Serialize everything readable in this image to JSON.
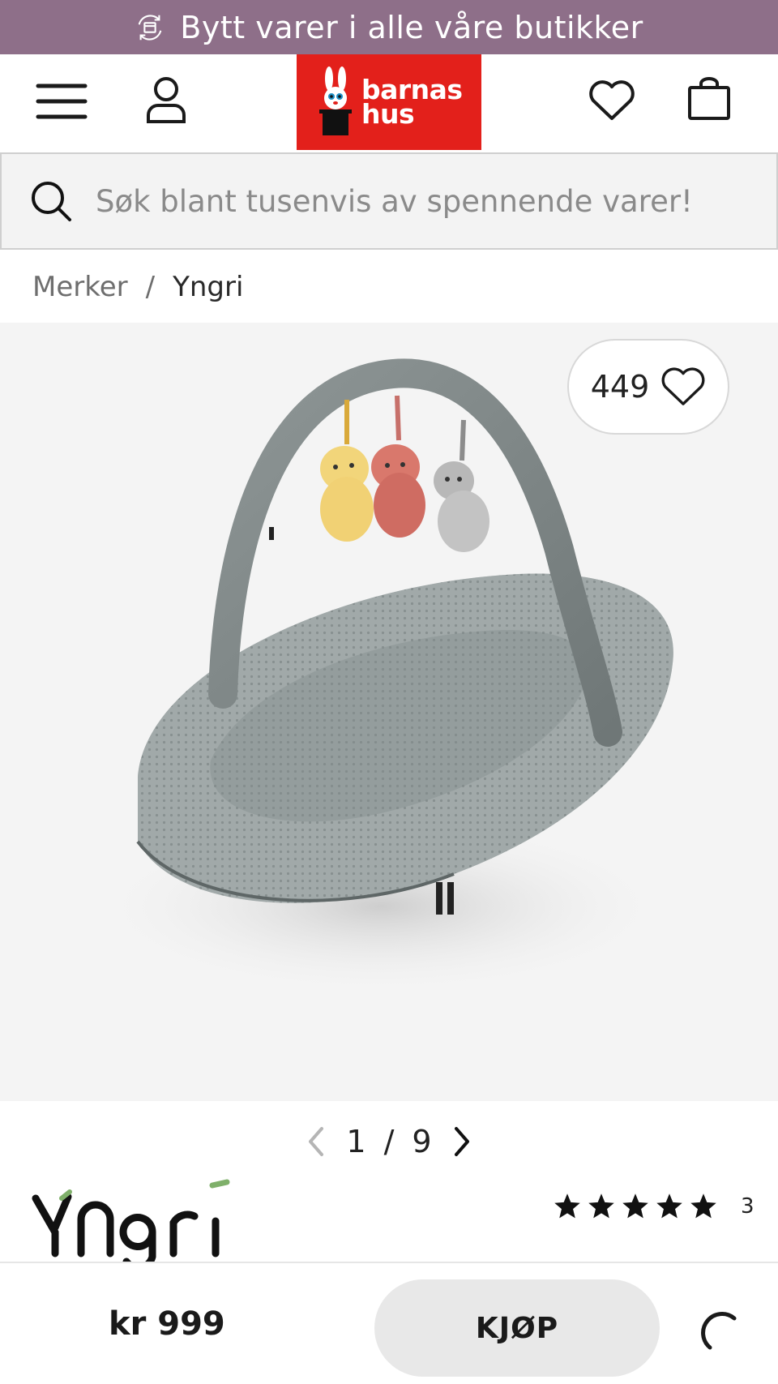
{
  "promo": {
    "text": "Bytt varer i alle våre butikker",
    "icon": "exchange-box-icon"
  },
  "header": {
    "logo_line1": "barnas",
    "logo_line2": "hus",
    "icons": [
      "menu-icon",
      "user-icon",
      "heart-icon",
      "shopping-bag-icon"
    ]
  },
  "search": {
    "placeholder": "Søk blant tusenvis av spennende varer!"
  },
  "breadcrumb": {
    "items": [
      "Merker",
      "Yngri"
    ],
    "separator": "/"
  },
  "gallery": {
    "favorite_count": "449",
    "pager": {
      "current": "1",
      "separator": "/",
      "total": "9"
    }
  },
  "product": {
    "brand": "Yngri",
    "rating_stars": 5,
    "review_count": "3"
  },
  "bottom_bar": {
    "price": "kr 999",
    "buy_label": "KJØP"
  },
  "colors": {
    "promo_bg": "#8e6f89",
    "logo_bg": "#e3201b",
    "buy_bg": "#e8e8e8",
    "gallery_bg": "#f4f4f4"
  }
}
